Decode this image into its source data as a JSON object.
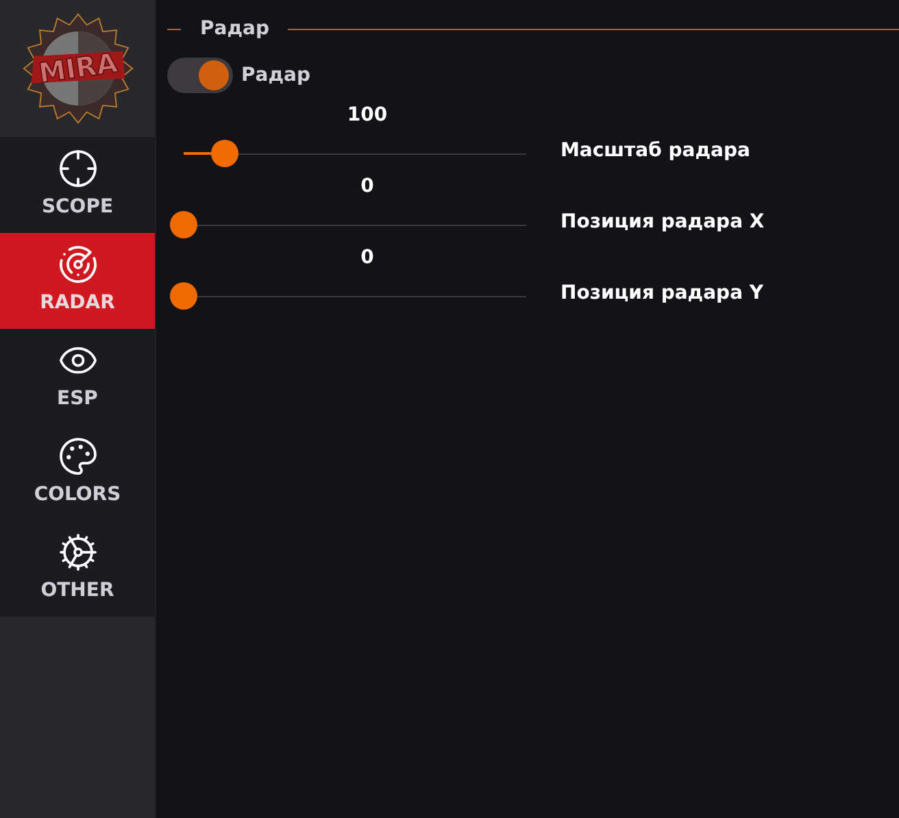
{
  "logo": {
    "text": "MIRA"
  },
  "nav": [
    {
      "kind": "scope",
      "label": "SCOPE",
      "selected": false
    },
    {
      "kind": "radar",
      "label": "RADAR",
      "selected": true
    },
    {
      "kind": "esp",
      "label": "ESP",
      "selected": false
    },
    {
      "kind": "colors",
      "label": "COLORS",
      "selected": false
    },
    {
      "kind": "other",
      "label": "OTHER",
      "selected": false
    }
  ],
  "section": {
    "title": "Радар"
  },
  "toggle": {
    "label": "Радар",
    "on": true
  },
  "sliders": [
    {
      "value": "100",
      "label": "Масштаб радара",
      "level": 0.12
    },
    {
      "value": "0",
      "label": "Позиция радара X",
      "level": 0
    },
    {
      "value": "0",
      "label": "Позиция радара Y",
      "level": 0
    }
  ]
}
